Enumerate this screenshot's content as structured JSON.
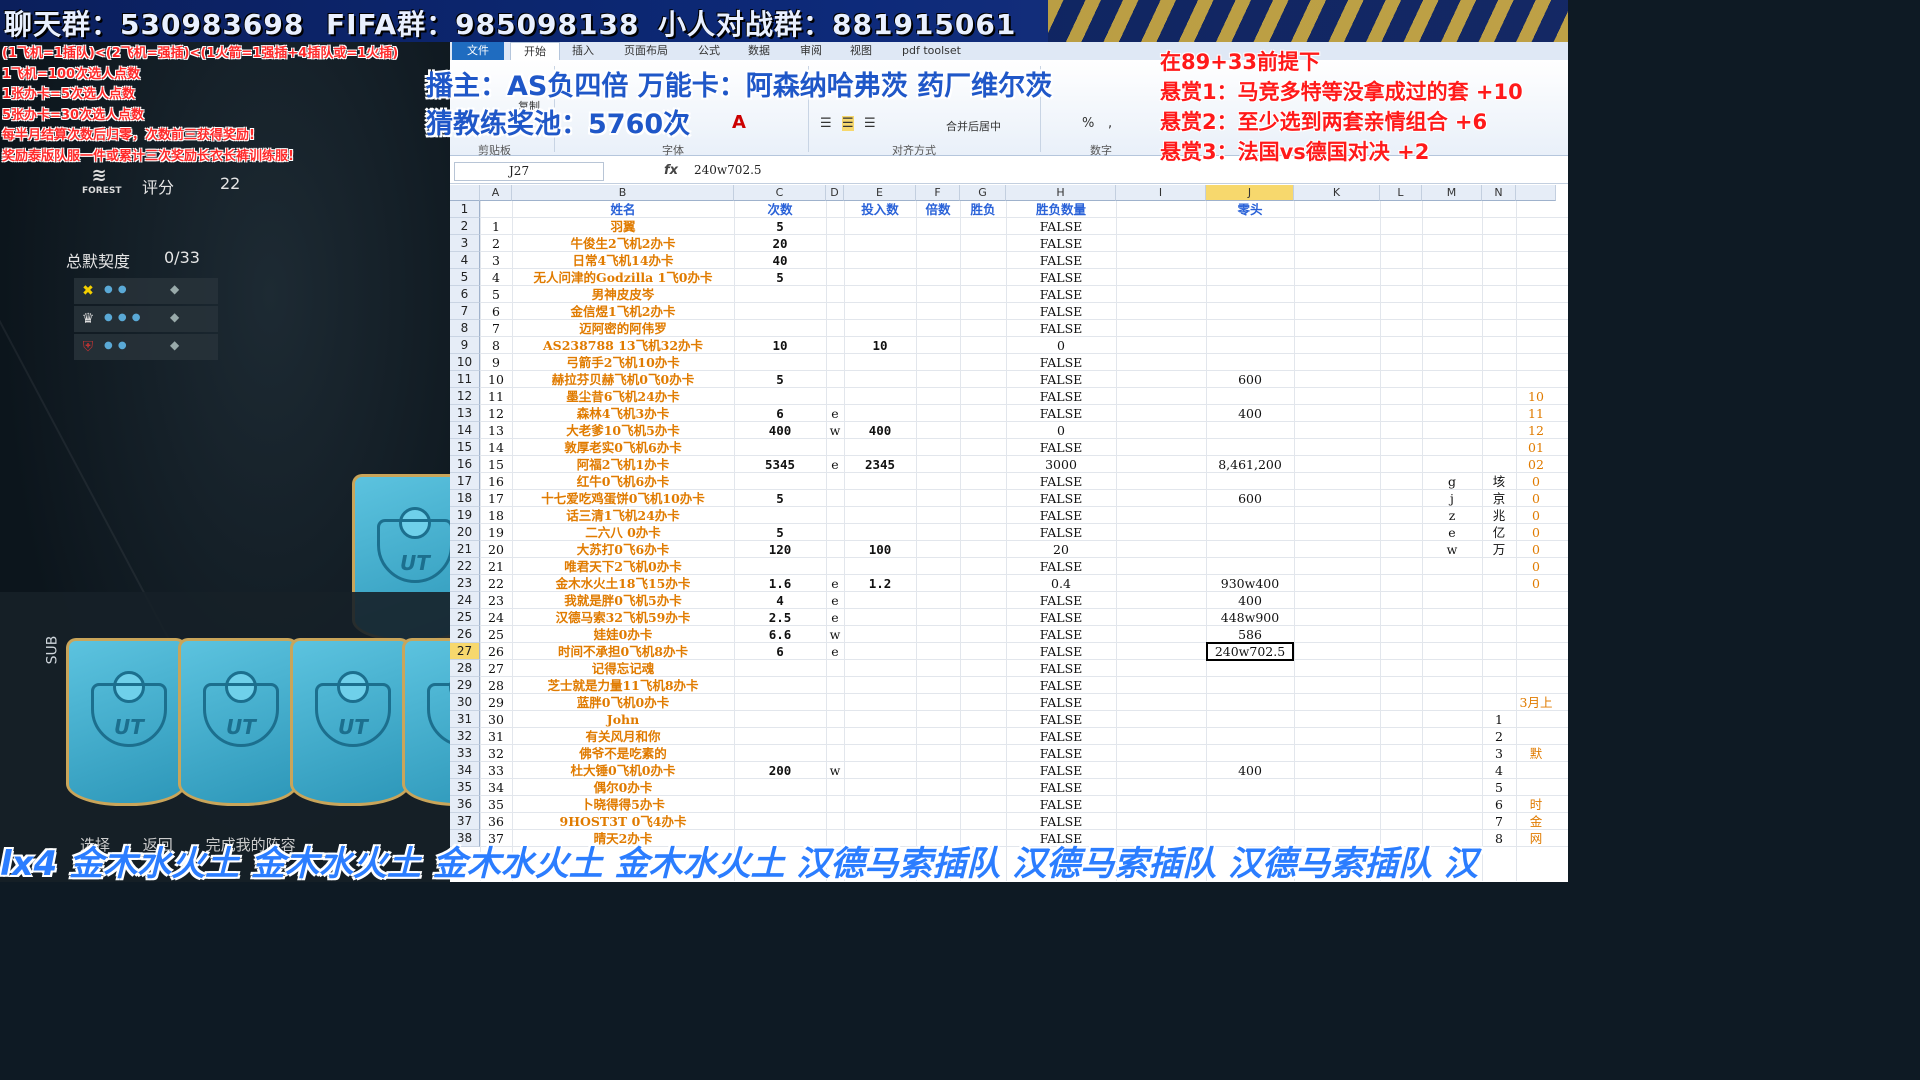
{
  "banner": {
    "chat_group": "聊天群：530983698",
    "fifa_group": "FIFA群：985098138",
    "battle_group": "小人对战群：881915061"
  },
  "rules": [
    "(1飞机=1插队)<(2飞机=强插)<(1火箭=1强插+4插队或=1火插)",
    "1飞机=100次选人点数",
    "1张办卡=5次选人点数",
    "5张办卡=30次选人点数",
    "每半月结算次数后归零，次数前三获得奖励!",
    "奖励泰版队服一件或累计三次奖励长衣长裤训练服!"
  ],
  "game": {
    "club_logo": "FOREST",
    "rating_label": "评分",
    "rating_value": "22",
    "chem_label": "总默契度",
    "chem_value": "0/33",
    "sub_label": "SUB",
    "card_label": "UT",
    "hints": [
      "选择",
      "返回",
      "完成我的阵容"
    ]
  },
  "excel": {
    "tabs": [
      "文件",
      "开始",
      "插入",
      "页面布局",
      "公式",
      "数据",
      "审阅",
      "视图",
      "pdf toolset"
    ],
    "ribbon_groups": [
      "剪贴板",
      "字体",
      "对齐方式",
      "数字"
    ],
    "ribbon_tools": {
      "copy": "复制",
      "merge": "合并后居中",
      "percent": "%",
      "comma": ","
    },
    "namebox": "J27",
    "fx": "fx",
    "formula": "240w702.5",
    "columns": [
      "A",
      "B",
      "C",
      "D",
      "E",
      "F",
      "G",
      "H",
      "I",
      "J",
      "K",
      "L",
      "M",
      "N"
    ],
    "header_row": [
      "",
      "姓名",
      "次数",
      "",
      "投入数",
      "倍数",
      "胜负",
      "胜负数量",
      "",
      "零头"
    ],
    "rows": [
      [
        "1",
        "羽翼",
        "5",
        "",
        "",
        "",
        "",
        "FALSE",
        "",
        ""
      ],
      [
        "2",
        "牛俊生2飞机2办卡",
        "20",
        "",
        "",
        "",
        "",
        "FALSE",
        "",
        ""
      ],
      [
        "3",
        "日常4飞机14办卡",
        "40",
        "",
        "",
        "",
        "",
        "FALSE",
        "",
        ""
      ],
      [
        "4",
        "无人问津的Godzilla 1飞0办卡",
        "5",
        "",
        "",
        "",
        "",
        "FALSE",
        "",
        ""
      ],
      [
        "5",
        "男神皮皮岑",
        "",
        "",
        "",
        "",
        "",
        "FALSE",
        "",
        ""
      ],
      [
        "6",
        "金信煜1飞机2办卡",
        "",
        "",
        "",
        "",
        "",
        "FALSE",
        "",
        ""
      ],
      [
        "7",
        "迈阿密的阿伟罗",
        "",
        "",
        "",
        "",
        "",
        "FALSE",
        "",
        ""
      ],
      [
        "8",
        "AS238788 13飞机32办卡",
        "10",
        "",
        "10",
        "",
        "",
        "0",
        "",
        ""
      ],
      [
        "9",
        "弓箭手2飞机10办卡",
        "",
        "",
        "",
        "",
        "",
        "FALSE",
        "",
        ""
      ],
      [
        "10",
        "赫拉芬贝赫飞机0飞0办卡",
        "5",
        "",
        "",
        "",
        "",
        "FALSE",
        "",
        "600"
      ],
      [
        "11",
        "墨尘昔6飞机24办卡",
        "",
        "",
        "",
        "",
        "",
        "FALSE",
        "",
        ""
      ],
      [
        "12",
        "森林4飞机3办卡",
        "6",
        "e",
        "",
        "",
        "",
        "FALSE",
        "",
        "400"
      ],
      [
        "13",
        "大老爹10飞机5办卡",
        "400",
        "w",
        "400",
        "",
        "",
        "0",
        "",
        ""
      ],
      [
        "14",
        "敦厚老实0飞机6办卡",
        "",
        "",
        "",
        "",
        "",
        "FALSE",
        "",
        ""
      ],
      [
        "15",
        "阿福2飞机1办卡",
        "5345",
        "e",
        "2345",
        "",
        "",
        "3000",
        "",
        "8,461,200"
      ],
      [
        "16",
        "红牛0飞机6办卡",
        "",
        "",
        "",
        "",
        "",
        "FALSE",
        "",
        ""
      ],
      [
        "17",
        "十七爱吃鸡蛋饼0飞机10办卡",
        "5",
        "",
        "",
        "",
        "",
        "FALSE",
        "",
        "600"
      ],
      [
        "18",
        "话三清1飞机24办卡",
        "",
        "",
        "",
        "",
        "",
        "FALSE",
        "",
        ""
      ],
      [
        "19",
        "二六八 0办卡",
        "5",
        "",
        "",
        "",
        "",
        "FALSE",
        "",
        ""
      ],
      [
        "20",
        "大苏打0飞6办卡",
        "120",
        "",
        "100",
        "",
        "",
        "20",
        "",
        ""
      ],
      [
        "21",
        "唯君天下2飞机0办卡",
        "",
        "",
        "",
        "",
        "",
        "FALSE",
        "",
        ""
      ],
      [
        "22",
        "金木水火土18飞15办卡",
        "1.6",
        "e",
        "1.2",
        "",
        "",
        "0.4",
        "",
        "930w400"
      ],
      [
        "23",
        "我就是胖0飞机5办卡",
        "4",
        "e",
        "",
        "",
        "",
        "FALSE",
        "",
        "400"
      ],
      [
        "24",
        "汉德马索32飞机59办卡",
        "2.5",
        "e",
        "",
        "",
        "",
        "FALSE",
        "",
        "448w900"
      ],
      [
        "25",
        "娃娃0办卡",
        "6.6",
        "w",
        "",
        "",
        "",
        "FALSE",
        "",
        "586"
      ],
      [
        "26",
        "时间不承担0飞机8办卡",
        "6",
        "e",
        "",
        "",
        "",
        "FALSE",
        "",
        "240w702.5"
      ],
      [
        "27",
        "记得忘记魂",
        "",
        "",
        "",
        "",
        "",
        "FALSE",
        "",
        ""
      ],
      [
        "28",
        "芝士就是力量11飞机8办卡",
        "",
        "",
        "",
        "",
        "",
        "FALSE",
        "",
        ""
      ],
      [
        "29",
        "蓝胖0飞机0办卡",
        "",
        "",
        "",
        "",
        "",
        "FALSE",
        "",
        ""
      ],
      [
        "30",
        "John",
        "",
        "",
        "",
        "",
        "",
        "FALSE",
        "",
        ""
      ],
      [
        "31",
        "有关风月和你",
        "",
        "",
        "",
        "",
        "",
        "FALSE",
        "",
        ""
      ],
      [
        "32",
        "佛爷不是吃素的",
        "",
        "",
        "",
        "",
        "",
        "FALSE",
        "",
        ""
      ],
      [
        "33",
        "杜大锤0飞机0办卡",
        "200",
        "w",
        "",
        "",
        "",
        "FALSE",
        "",
        "400"
      ],
      [
        "34",
        "偶尔0办卡",
        "",
        "",
        "",
        "",
        "",
        "FALSE",
        "",
        ""
      ],
      [
        "35",
        "卜晓得得5办卡",
        "",
        "",
        "",
        "",
        "",
        "FALSE",
        "",
        ""
      ],
      [
        "36",
        "9HOST3T 0飞4办卡",
        "",
        "",
        "",
        "",
        "",
        "FALSE",
        "",
        ""
      ],
      [
        "37",
        "晴天2办卡",
        "",
        "",
        "",
        "",
        "",
        "FALSE",
        "",
        ""
      ]
    ],
    "side_m": {
      "17": "g",
      "18": "j",
      "19": "z",
      "20": "e",
      "21": "w"
    },
    "side_n": {
      "17": "垓",
      "18": "京",
      "19": "兆",
      "20": "亿",
      "21": "万",
      "31": "1",
      "32": "2",
      "33": "3",
      "34": "4",
      "35": "5",
      "36": "6",
      "37": "7",
      "38": "8"
    },
    "side_o": {
      "12": "10",
      "13": "11",
      "14": "12",
      "15": "01",
      "16": "02",
      "17": "0",
      "18": "0",
      "19": "0",
      "20": "0",
      "21": "0",
      "22": "0",
      "23": "0",
      "30": "3月上",
      "33": "默",
      "36": "时",
      "37": "金",
      "38": "网"
    }
  },
  "overlay": {
    "host": "播主：AS负四倍 万能卡：阿森纳哈弗茨 药厂维尔茨",
    "pool": "猜教练奖池：5760次",
    "bounty_title": "在89+33前提下",
    "bounties": [
      "悬赏1：马竞多特等没拿成过的套 +10",
      "悬赏2：至少选到两套亲情组合 +6",
      "悬赏3：法国vs德国对决 +2"
    ],
    "ticker": "lx4 金木水火土 金木水火土 金木水火土 金木水火土 汉德马索插队 汉德马索插队 汉德马索插队 汉"
  }
}
